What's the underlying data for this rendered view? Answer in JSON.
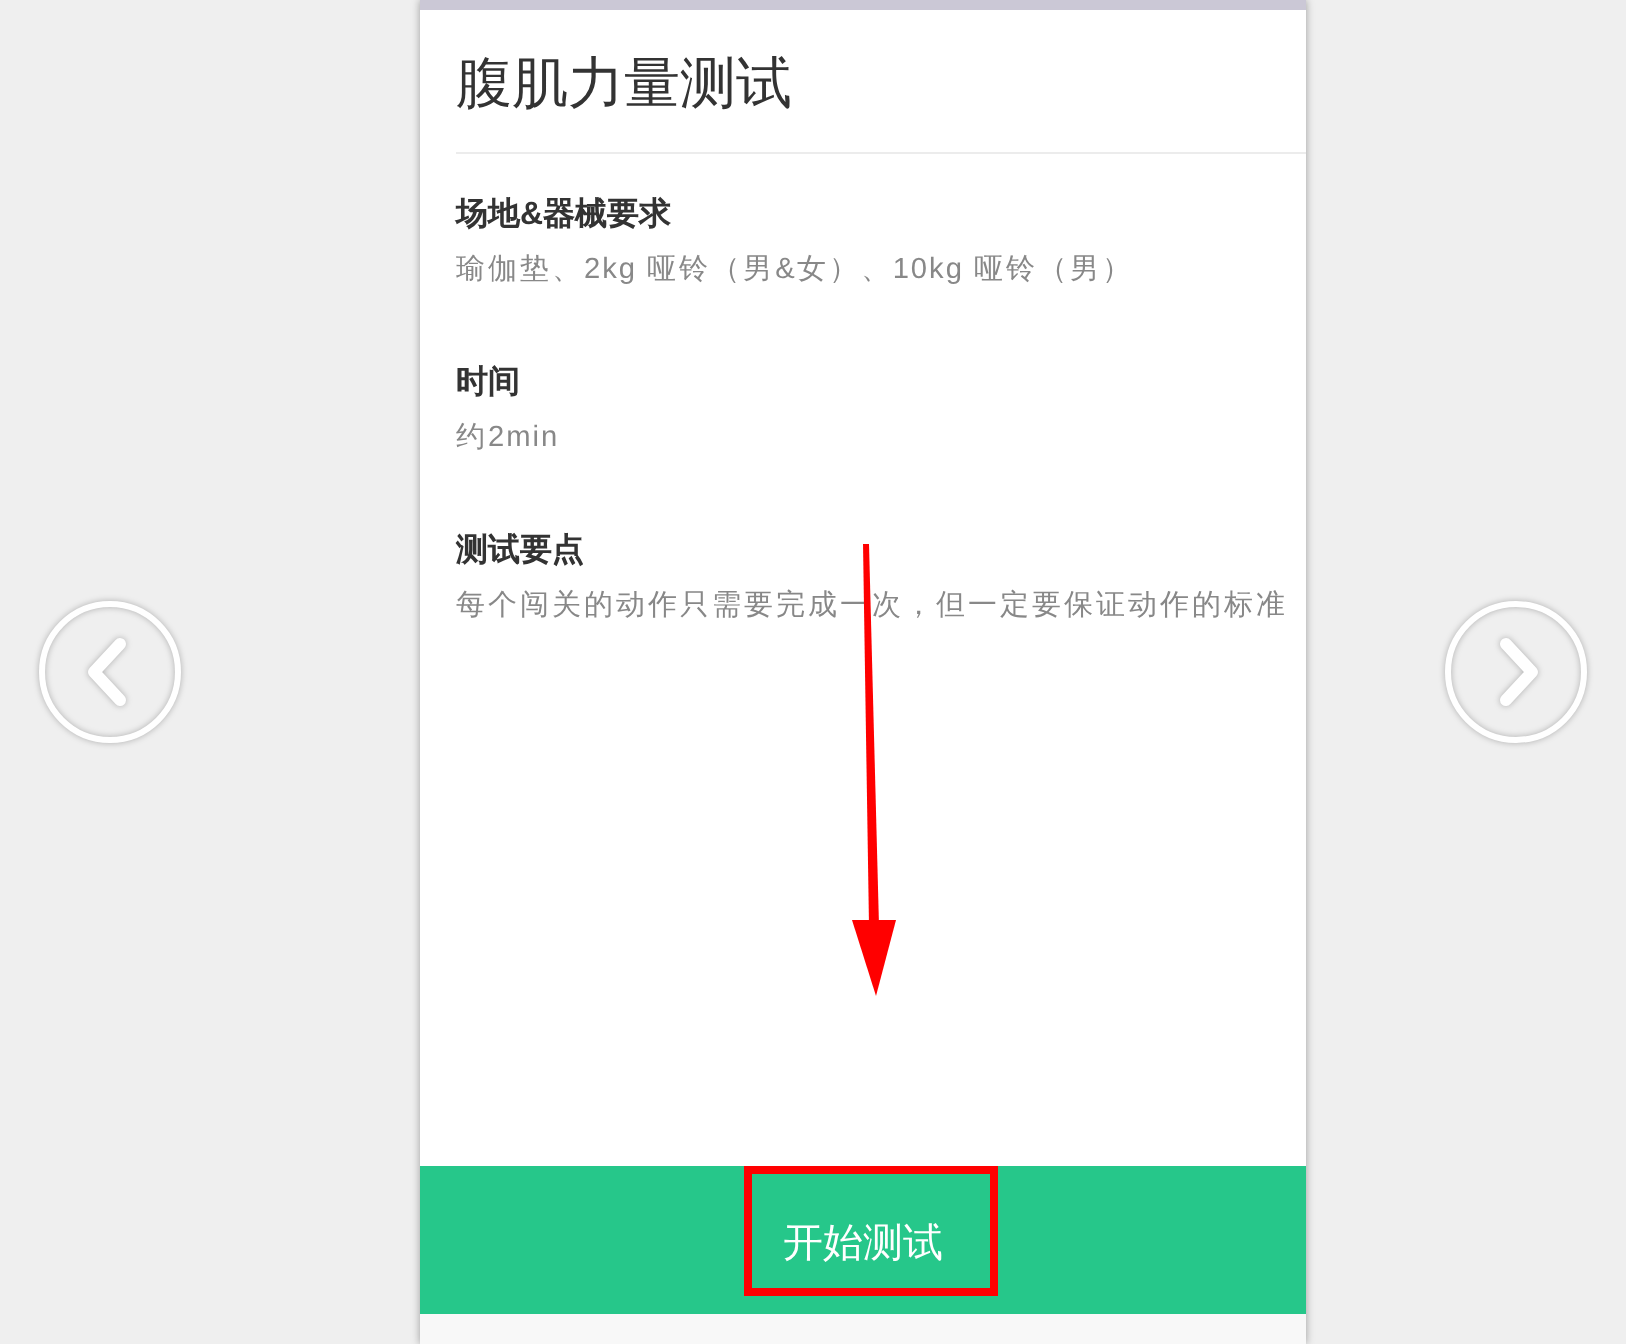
{
  "title": "腹肌力量测试",
  "sections": [
    {
      "heading": "场地&器械要求",
      "text": "瑜伽垫、2kg 哑铃（男&女）、10kg 哑铃（男）"
    },
    {
      "heading": "时间",
      "text": "约2min"
    },
    {
      "heading": "测试要点",
      "text": "每个闯关的动作只需要完成一次，但一定要保证动作的标准"
    }
  ],
  "start_button": {
    "label": "开始测试"
  }
}
